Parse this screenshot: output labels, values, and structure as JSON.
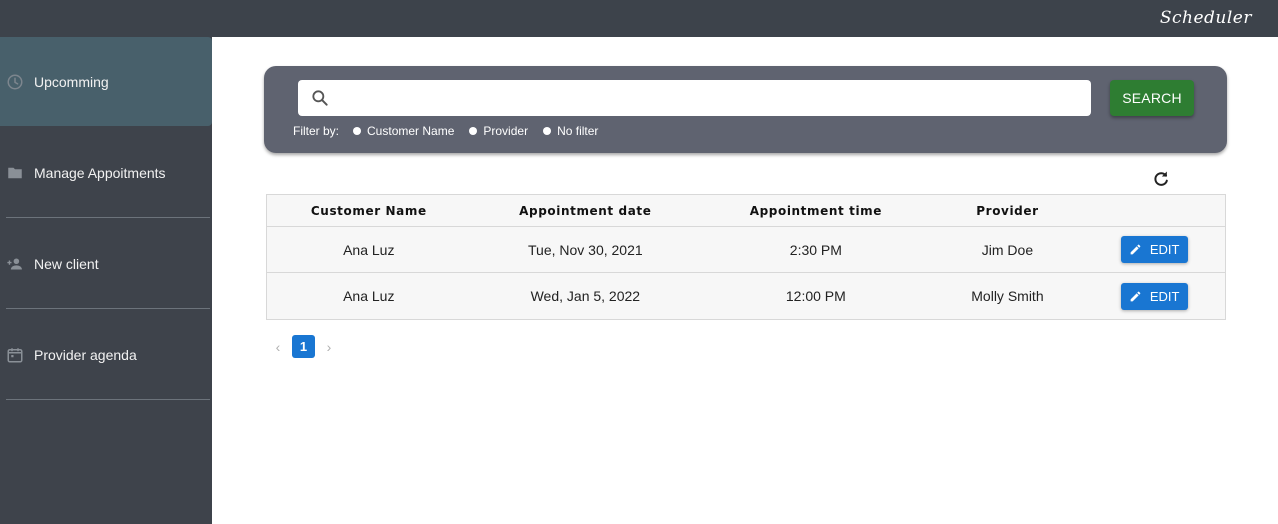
{
  "app": {
    "title": "Scheduler"
  },
  "sidebar": {
    "items": [
      {
        "label": "Upcomming",
        "icon": "clock-icon",
        "active": true
      },
      {
        "label": "Manage Appoitments",
        "icon": "folder-icon",
        "active": false
      },
      {
        "label": "New client",
        "icon": "person-add-icon",
        "active": false
      },
      {
        "label": "Provider agenda",
        "icon": "calendar-icon",
        "active": false
      }
    ]
  },
  "search": {
    "placeholder": "",
    "value": "",
    "button_label": "SEARCH",
    "filter_label": "Filter by:",
    "filters": [
      "Customer Name",
      "Provider",
      "No filter"
    ]
  },
  "table": {
    "columns": [
      "Customer Name",
      "Appointment date",
      "Appointment time",
      "Provider"
    ],
    "rows": [
      {
        "customer": "Ana Luz",
        "date": "Tue, Nov 30, 2021",
        "time": "2:30 PM",
        "provider": "Jim Doe",
        "action": "EDIT"
      },
      {
        "customer": "Ana Luz",
        "date": "Wed, Jan 5, 2022",
        "time": "12:00 PM",
        "provider": "Molly Smith",
        "action": "EDIT"
      }
    ]
  },
  "pagination": {
    "prev": "‹",
    "current": "1",
    "next": "›"
  },
  "colors": {
    "topbar": "#3d434b",
    "sidebar": "#3e434b",
    "sidebar_active": "#48606b",
    "search_panel": "#5f6370",
    "search_button": "#2e7d32",
    "edit_button": "#1976d2"
  }
}
